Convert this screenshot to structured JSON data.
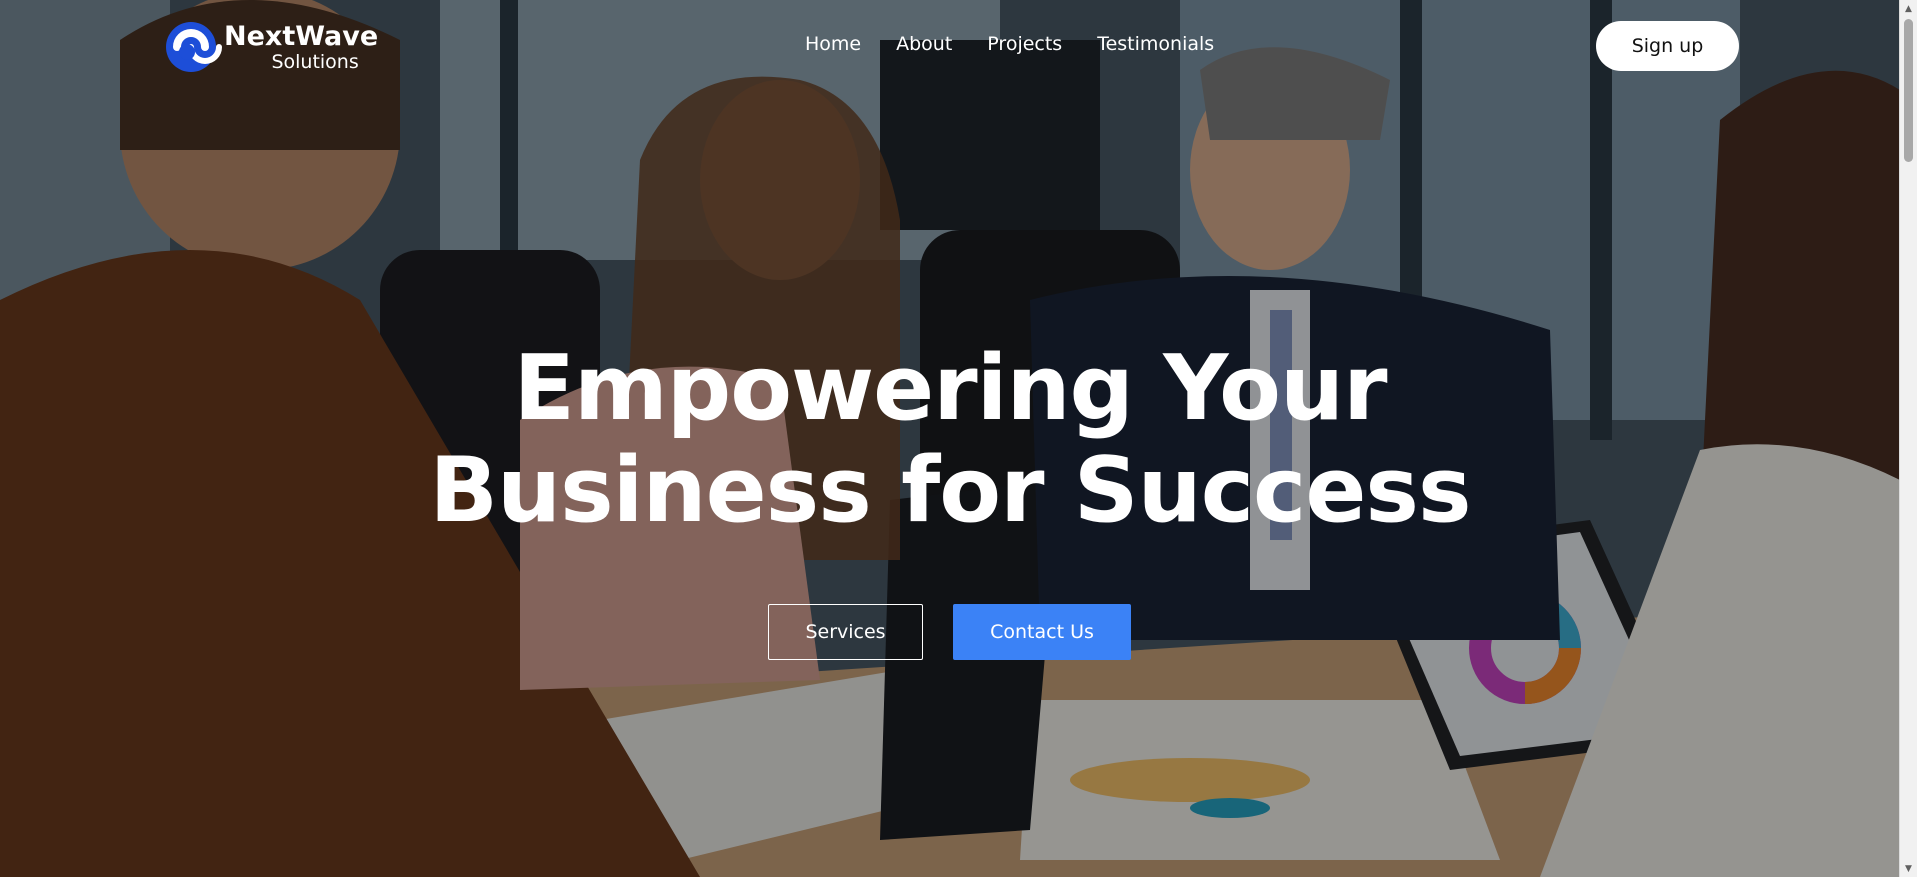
{
  "brand": {
    "name": "NextWave",
    "tagline": "Solutions",
    "accent_color": "#1d4ed8",
    "logo_icon": "wave-swirl-logo-icon"
  },
  "nav": {
    "items": [
      {
        "label": "Home"
      },
      {
        "label": "About"
      },
      {
        "label": "Projects"
      },
      {
        "label": "Testimonials"
      }
    ],
    "signup_label": "Sign up"
  },
  "hero": {
    "headline_line1": "Empowering Your",
    "headline_line2": "Business for Success",
    "background_image": "business-meeting-photo",
    "services_label": "Services",
    "contact_label": "Contact Us",
    "contact_color": "#3b82f6"
  }
}
